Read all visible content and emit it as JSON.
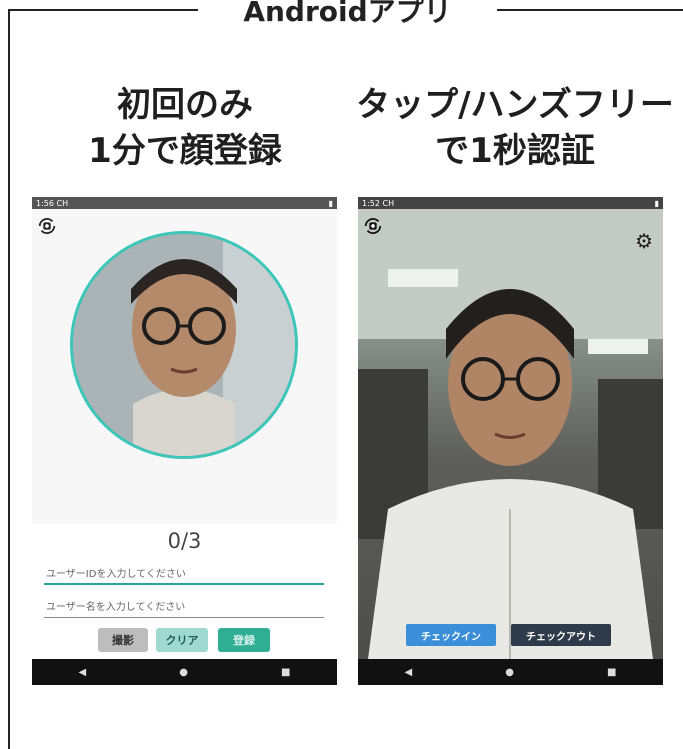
{
  "frame": {
    "title": "Androidアプリ"
  },
  "left_panel": {
    "headline_line1": "初回のみ",
    "headline_line2": "1分で顔登録",
    "phone": {
      "status_time": "1:56 CH",
      "counter": "0/3",
      "user_id_placeholder": "ユーザーIDを入力してください",
      "user_name_placeholder": "ユーザー名を入力してください",
      "capture_label": "撮影",
      "clear_label": "クリア",
      "register_label": "登録"
    }
  },
  "right_panel": {
    "headline_line1": "タップ/ハンズフリー",
    "headline_line2": "で1秒認証",
    "phone": {
      "status_time": "1:52 CH",
      "checkin_label": "チェックイン",
      "checkout_label": "チェックアウト"
    }
  },
  "colors": {
    "accent": "#2fae93",
    "checkin": "#3a8fd8",
    "checkout": "#2f3a4a"
  },
  "icons": [
    "rotate-camera-icon",
    "gear-icon",
    "back-icon",
    "home-icon",
    "recents-icon"
  ]
}
